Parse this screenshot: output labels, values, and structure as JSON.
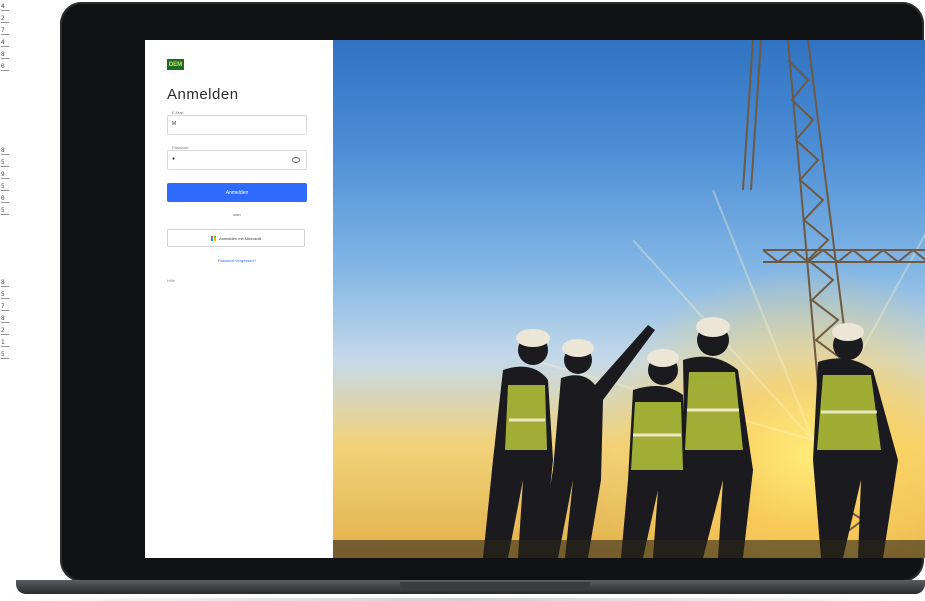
{
  "edge_numbers": [
    "4",
    "2",
    "7",
    "4",
    "8",
    "0",
    "8",
    "5",
    "9",
    "5",
    "0",
    "5",
    "8",
    "5",
    "7",
    "8",
    "2",
    "1",
    "5"
  ],
  "login": {
    "logo_text": "DEM",
    "title": "Anmelden",
    "username": {
      "label": "E-Mail",
      "value": "M"
    },
    "password": {
      "label": "Passwort",
      "value": "●"
    },
    "submit_label": "Anmelden",
    "or_text": "oder",
    "microsoft_label": "Anmelden mit Microsoft",
    "forgot_link": "Passwort vergessen?",
    "footer_text": "Hilfe"
  },
  "colors": {
    "primary": "#2f6bff",
    "logo_bg": "#1c6b2a"
  },
  "icons": [
    "eye-icon",
    "microsoft-icon"
  ]
}
